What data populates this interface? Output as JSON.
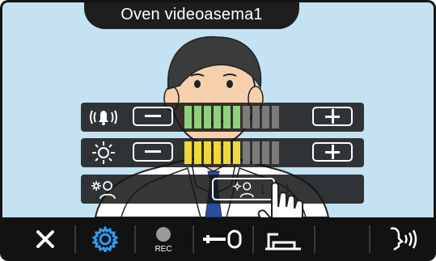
{
  "header": {
    "title": "Oven videoasema1"
  },
  "adjust_panel": {
    "volume_row": {
      "icon": "bell-volume-icon",
      "level": 6,
      "max": 10,
      "fill_color": "#8ed17c"
    },
    "brightness_row": {
      "icon": "brightness-sun-icon",
      "level": 6,
      "max": 10,
      "fill_color": "#f0d83a"
    },
    "backlight_row": {
      "icon": "backlight-person-icon",
      "button_icon": "backlight-compensation-icon"
    }
  },
  "toolbar": {
    "buttons": [
      {
        "name": "close",
        "icon": "close-icon"
      },
      {
        "name": "settings",
        "icon": "gear-icon",
        "active_color": "#2e9bf0"
      },
      {
        "name": "record",
        "icon": "record-icon",
        "label": "REC"
      },
      {
        "name": "door-release",
        "icon": "door-key-icon"
      },
      {
        "name": "light",
        "icon": "light-icon"
      },
      {
        "name": "empty",
        "icon": ""
      },
      {
        "name": "talk",
        "icon": "talk-icon"
      }
    ]
  },
  "colors": {
    "segment_inactive": "#7b7b7b",
    "panel_bg": "#141414",
    "screen_bg": "#c5e2f2"
  }
}
